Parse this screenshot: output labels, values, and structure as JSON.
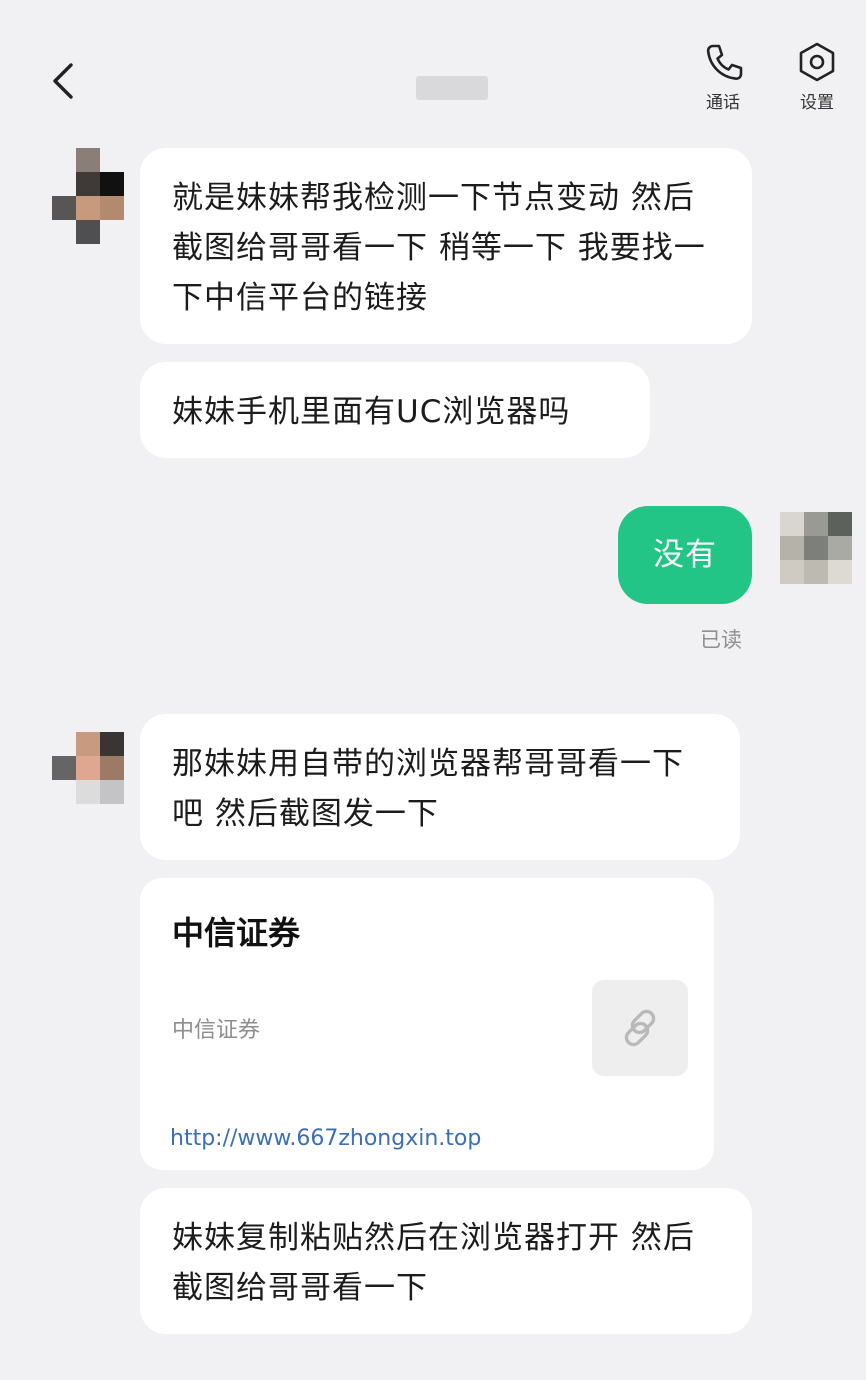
{
  "header": {
    "call_label": "通话",
    "settings_label": "设置",
    "back_icon": "chevron-left-icon",
    "call_icon": "phone-icon",
    "settings_icon": "hexagon-gear-icon"
  },
  "messages": [
    {
      "text": "就是妹妹帮我检测一下节点变动 然后截图给哥哥看一下 稍等一下 我要找一下中信平台的链接"
    },
    {
      "text": "妹妹手机里面有UC浏览器吗"
    },
    {
      "text": "没有",
      "read_status": "已读"
    },
    {
      "text": "那妹妹用自带的浏览器帮哥哥看一下吧 然后截图发一下"
    },
    {
      "text": "妹妹复制粘贴然后在浏览器打开 然后截图给哥哥看一下"
    }
  ],
  "link_card": {
    "title": "中信证券",
    "description": "中信证券",
    "url": "http://www.667zhongxin.top",
    "thumb_icon": "link-icon"
  },
  "colors": {
    "background": "#f1f1f3",
    "bubble_incoming": "#ffffff",
    "bubble_outgoing": "#22c586",
    "link_text": "#3c6fb4"
  }
}
